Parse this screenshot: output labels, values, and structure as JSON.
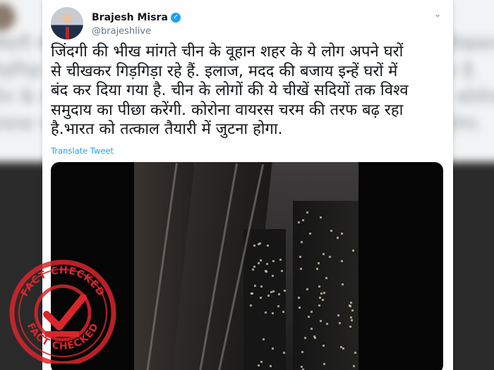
{
  "tweet": {
    "display_name": "Brajesh Misra",
    "handle": "@brajeshlive",
    "text": "जिंदगी की भीख मांगते चीन के वूहान शहर के ये लोग अपने घरों\nसे चीखकर गिड़गिड़ा रहे हैं. इलाज, मदद की बजाय इन्हें घरों में\nबंद कर दिया गया है. चीन के लोगों की ये चीखें सदियों तक विश्व\nसमुदाय का पीछा करेंगी. कोरोना वायरस चरम की तरफ बढ़ रहा\nहै.भारत को तत्काल तैयारी में जुटना होगा.",
    "translate_label": "Translate Tweet",
    "verified_icon": "✓",
    "menu_icon": "⌄"
  },
  "stamp": {
    "top_text": "FACT CHECKED",
    "bottom_text": "FACT CHECKED",
    "color": "#d8262b"
  },
  "colors": {
    "link": "#1da1f2",
    "text": "#14171a",
    "muted": "#657786"
  }
}
